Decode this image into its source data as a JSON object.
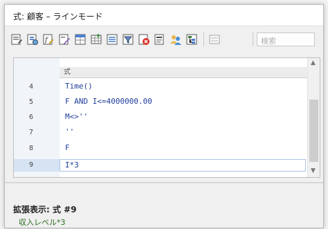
{
  "window": {
    "title": "式: 顧客 – ラインモード"
  },
  "toolbar": {
    "icons": [
      "edit-icon",
      "expression-icon",
      "function-icon",
      "edit-note-icon",
      "table-icon",
      "insert-table-icon",
      "field-list-icon",
      "filter-icon",
      "delete-icon",
      "sheet-icon",
      "users-icon",
      "tree-icon",
      "settings-icon"
    ],
    "search_placeholder": "検索"
  },
  "editor": {
    "column_header": "式",
    "lines": [
      {
        "no": "4",
        "text": "Time()"
      },
      {
        "no": "5",
        "text": "F AND I<=4000000.00"
      },
      {
        "no": "6",
        "text": "M<>''"
      },
      {
        "no": "7",
        "text": "''"
      },
      {
        "no": "8",
        "text": "F"
      },
      {
        "no": "9",
        "text": "I*3"
      }
    ],
    "selected_line": "9"
  },
  "detail": {
    "title": "拡張表示: 式 #9",
    "text": "収入レベル*3"
  }
}
